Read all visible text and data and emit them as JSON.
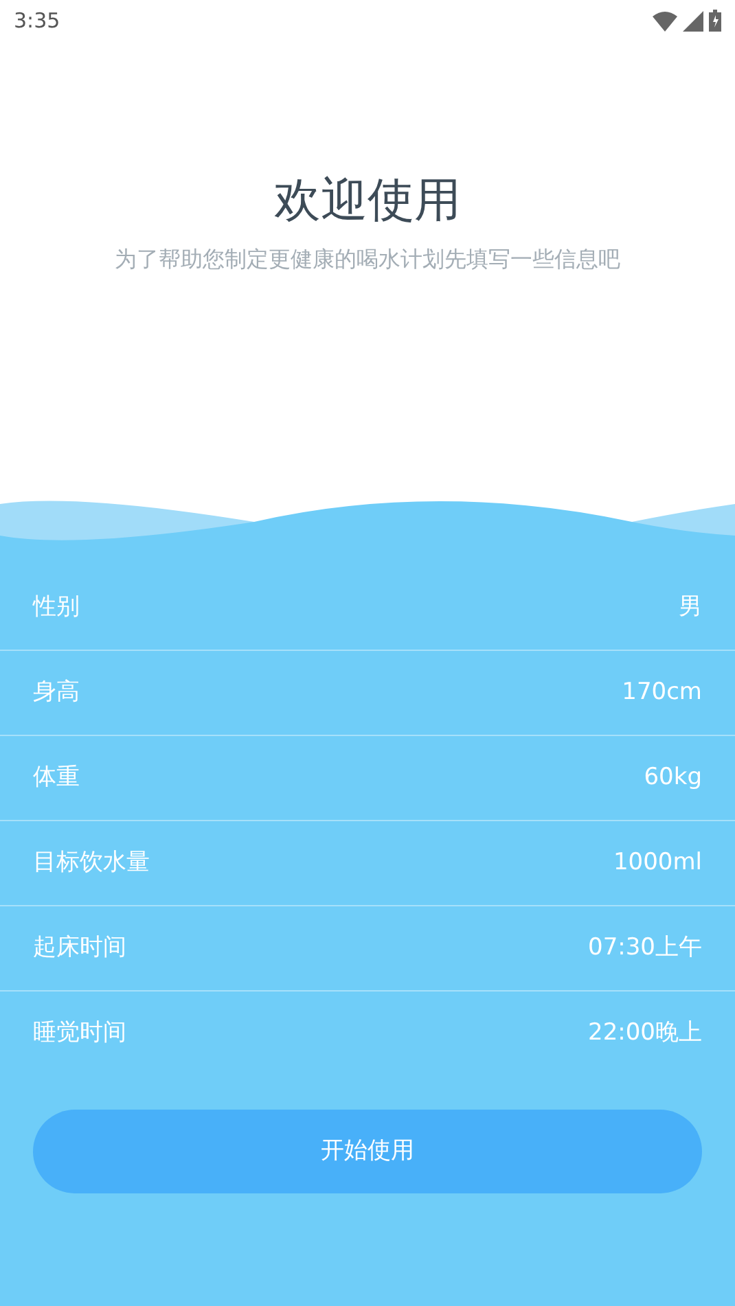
{
  "status_bar": {
    "time": "3:35"
  },
  "title": "欢迎使用",
  "subtitle": "为了帮助您制定更健康的喝水计划先填写一些信息吧",
  "fields": [
    {
      "label": "性别",
      "value": "男"
    },
    {
      "label": "身高",
      "value": "170cm"
    },
    {
      "label": "体重",
      "value": "60kg"
    },
    {
      "label": "目标饮水量",
      "value": "1000ml"
    },
    {
      "label": "起床时间",
      "value": "07:30上午"
    },
    {
      "label": "睡觉时间",
      "value": "22:00晚上"
    }
  ],
  "start_button": "开始使用"
}
